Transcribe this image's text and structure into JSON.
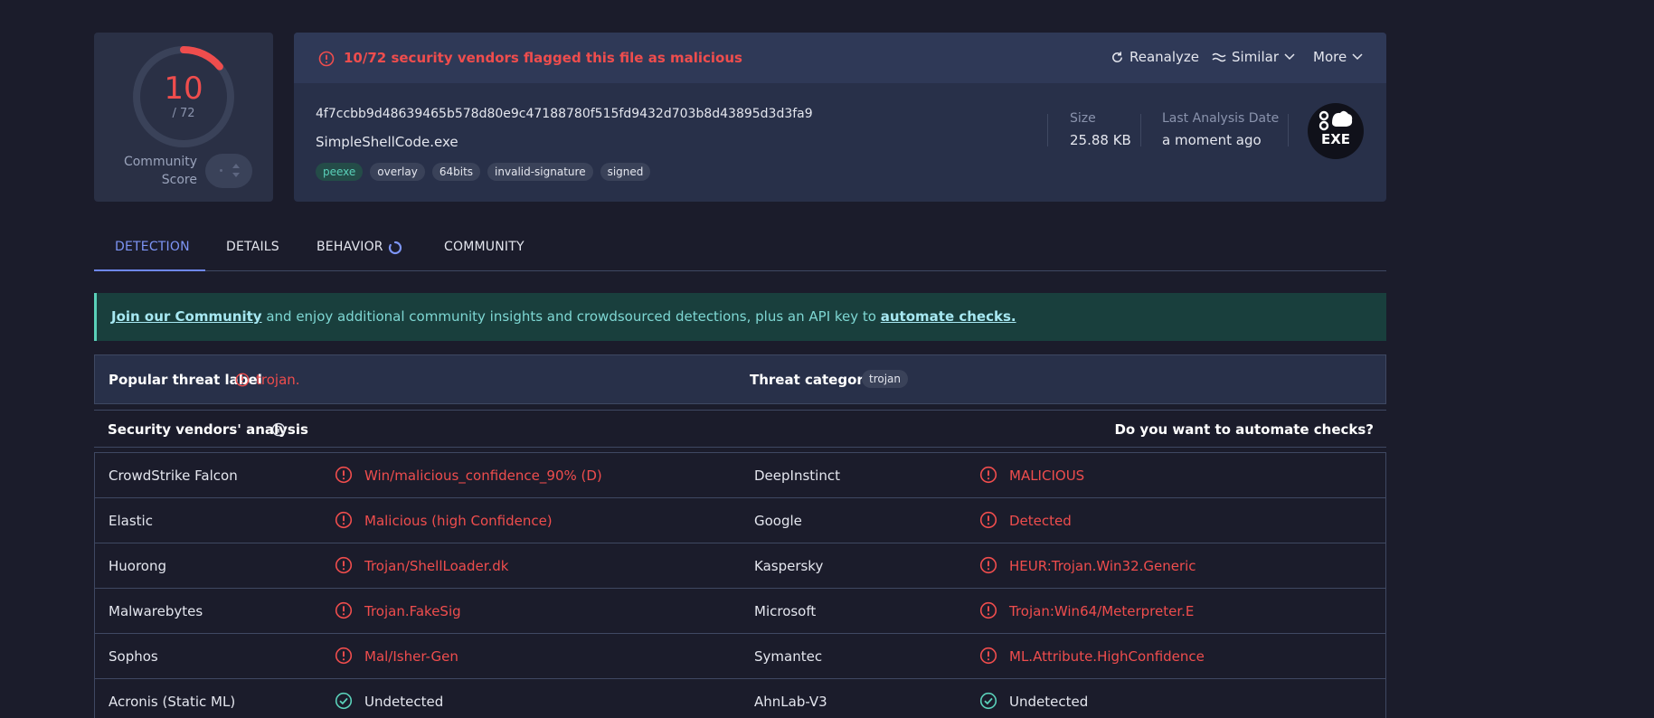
{
  "score": {
    "detected": "10",
    "total": "/ 72",
    "detected_fraction": 0.139,
    "community_label_1": "Community",
    "community_label_2": "Score"
  },
  "banner_header": {
    "flag_text": "10/72 security vendors flagged this file as malicious",
    "reanalyze": "Reanalyze",
    "similar": "Similar",
    "more": "More"
  },
  "file": {
    "hash": "4f7ccbb9d48639465b578d80e9c47188780f515fd9432d703b8d43895d3d3fa9",
    "name": "SimpleShellCode.exe",
    "tags": [
      "peexe",
      "overlay",
      "64bits",
      "invalid-signature",
      "signed"
    ],
    "size_label": "Size",
    "size_value": "25.88 KB",
    "date_label": "Last Analysis Date",
    "date_value": "a moment ago",
    "type_badge": "EXE"
  },
  "tabs": [
    "DETECTION",
    "DETAILS",
    "BEHAVIOR",
    "COMMUNITY"
  ],
  "join_banner": {
    "link1": "Join our Community",
    "middle": " and enjoy additional community insights and crowdsourced detections, plus an API key to ",
    "link2": "automate checks."
  },
  "threat": {
    "popular_label": "Popular threat label",
    "popular_value": "trojan.",
    "categories_label": "Threat categories",
    "category": "trojan"
  },
  "analysis": {
    "title": "Security vendors' analysis",
    "automate": "Do you want to automate checks?"
  },
  "vendors": [
    [
      {
        "name": "CrowdStrike Falcon",
        "result": "Win/malicious_confidence_90% (D)",
        "status": "malicious"
      },
      {
        "name": "DeepInstinct",
        "result": "MALICIOUS",
        "status": "malicious"
      }
    ],
    [
      {
        "name": "Elastic",
        "result": "Malicious (high Confidence)",
        "status": "malicious"
      },
      {
        "name": "Google",
        "result": "Detected",
        "status": "malicious"
      }
    ],
    [
      {
        "name": "Huorong",
        "result": "Trojan/ShellLoader.dk",
        "status": "malicious"
      },
      {
        "name": "Kaspersky",
        "result": "HEUR:Trojan.Win32.Generic",
        "status": "malicious"
      }
    ],
    [
      {
        "name": "Malwarebytes",
        "result": "Trojan.FakeSig",
        "status": "malicious"
      },
      {
        "name": "Microsoft",
        "result": "Trojan:Win64/Meterpreter.E",
        "status": "malicious"
      }
    ],
    [
      {
        "name": "Sophos",
        "result": "Mal/Isher-Gen",
        "status": "malicious"
      },
      {
        "name": "Symantec",
        "result": "ML.Attribute.HighConfidence",
        "status": "malicious"
      }
    ],
    [
      {
        "name": "Acronis (Static ML)",
        "result": "Undetected",
        "status": "undetected"
      },
      {
        "name": "AhnLab-V3",
        "result": "Undetected",
        "status": "undetected"
      }
    ]
  ],
  "colors": {
    "malicious": "#ef4d4d",
    "undetected": "#5ad0b9",
    "accent": "#6e87f0"
  }
}
